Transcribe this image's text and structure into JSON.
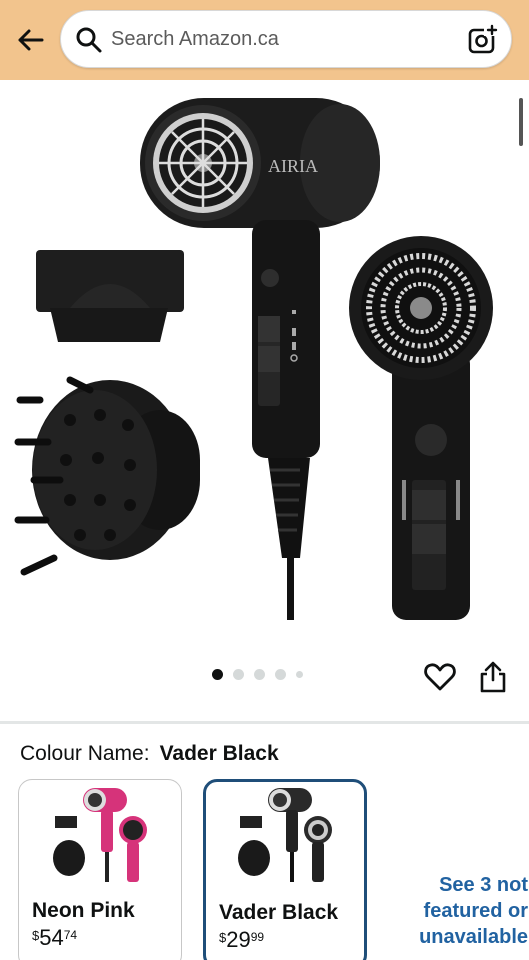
{
  "header": {
    "search_placeholder": "Search Amazon.ca",
    "background": "#f2c48d"
  },
  "icons": {
    "back": "arrow-left-icon",
    "search": "search-icon",
    "camera": "camera-lens-icon",
    "wishlist": "heart-icon",
    "share": "share-icon"
  },
  "gallery": {
    "total_images": 5,
    "active_index": 0
  },
  "colour": {
    "label": "Colour Name:",
    "selected": "Vader Black"
  },
  "swatches": [
    {
      "name": "Neon Pink",
      "currency": "$",
      "price_whole": "54",
      "price_cents": "74",
      "accent": "#d6337a"
    },
    {
      "name": "Vader Black",
      "currency": "$",
      "price_whole": "29",
      "price_cents": "99",
      "accent": "#333333"
    }
  ],
  "see_more": {
    "line1": "See 3 not",
    "line2": "featured or",
    "line3": "unavailable"
  },
  "colors": {
    "link": "#2162a1",
    "selected_border": "#1f4e79"
  }
}
